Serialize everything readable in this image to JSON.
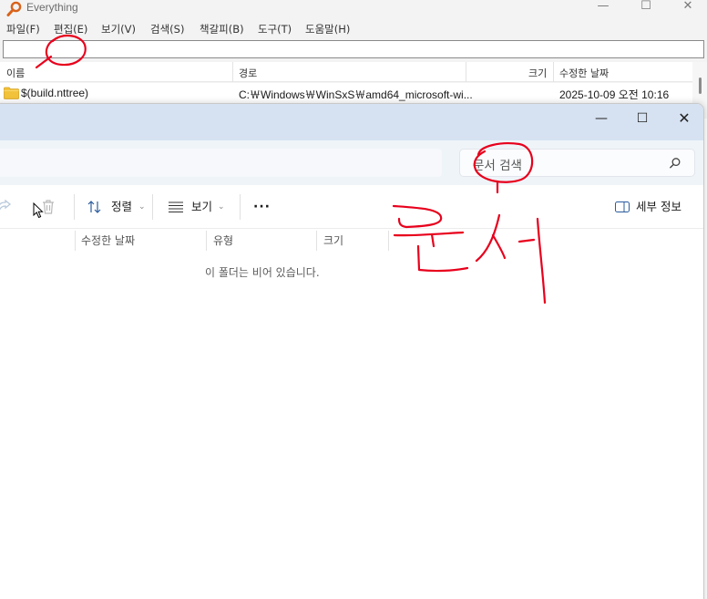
{
  "everything": {
    "title": "Everything",
    "menu": [
      "파일(F)",
      "편집(E)",
      "보기(V)",
      "검색(S)",
      "책갈피(B)",
      "도구(T)",
      "도움말(H)"
    ],
    "search": {
      "value": "",
      "placeholder": ""
    },
    "columns": {
      "name": "이름",
      "path": "경로",
      "size": "크기",
      "modified": "수정한 날짜"
    },
    "rows": [
      {
        "name": "$(build.nttree)",
        "path": "C:￦Windows￦WinSxS￦amd64_microsoft-wi...",
        "size": "",
        "modified": "2025-10-09 오전 10:16",
        "icon": "folder-icon"
      }
    ],
    "window_controls": {
      "minimize": "—",
      "maximize": "☐",
      "close": "✕"
    }
  },
  "explorer": {
    "window_controls": {
      "minimize": "—",
      "maximize": "☐",
      "close": "✕"
    },
    "search_placeholder": "문서 검색",
    "toolbar": {
      "sort": "정렬",
      "view": "보기",
      "more": "···",
      "details": "세부 정보"
    },
    "columns": {
      "modified": "수정한 날짜",
      "type": "유형",
      "size": "크기"
    },
    "empty_message": "이 폴더는 비어 있습니다."
  },
  "colors": {
    "annotation_red": "#e8001c",
    "explorer_titlebar": "#d6e2f1",
    "folder": "#f2c23a"
  }
}
